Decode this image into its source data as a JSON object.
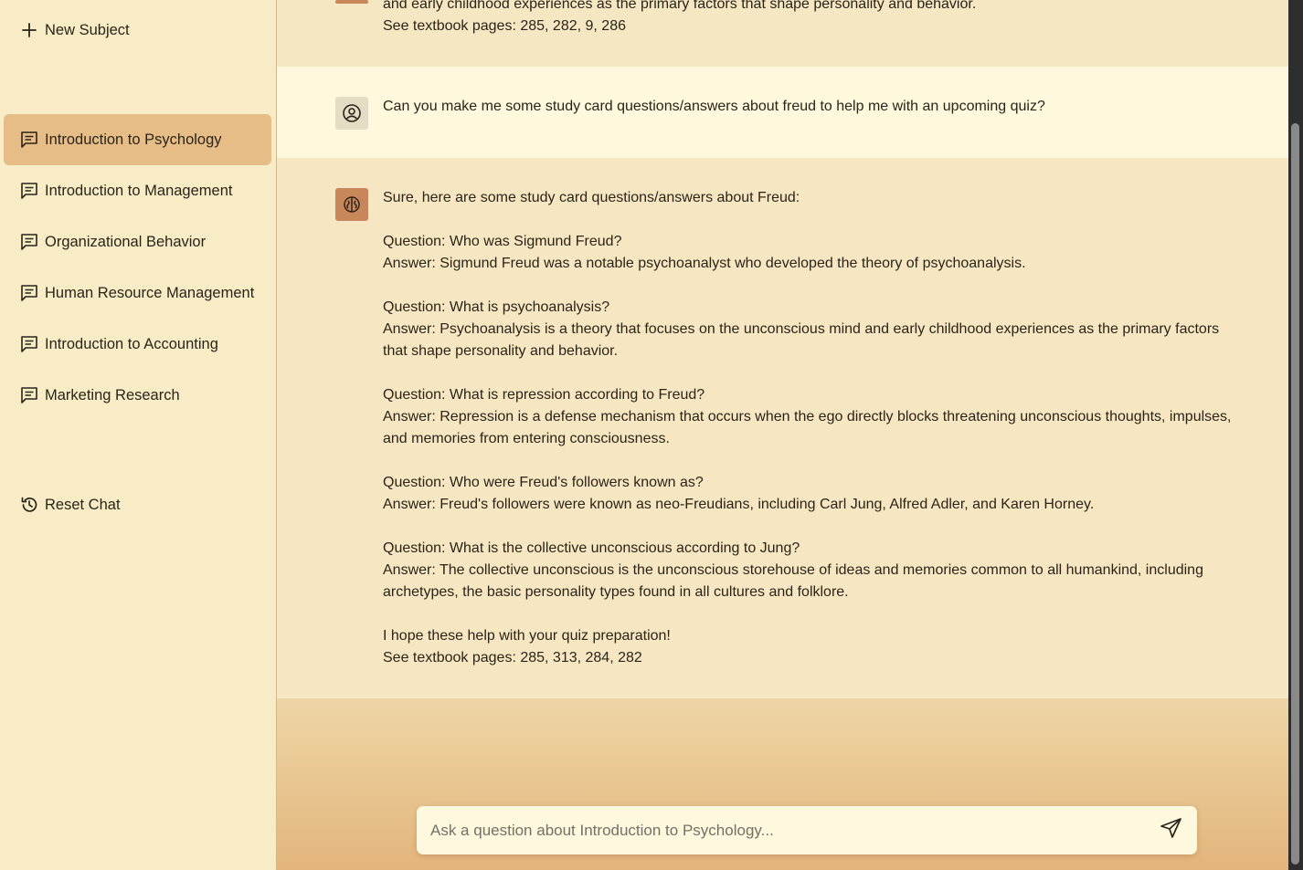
{
  "sidebar": {
    "new_subject_label": "New Subject",
    "subjects": [
      {
        "label": "Introduction to Psychology",
        "active": true
      },
      {
        "label": "Introduction to Management",
        "active": false
      },
      {
        "label": "Organizational Behavior",
        "active": false
      },
      {
        "label": "Human Resource Management",
        "active": false
      },
      {
        "label": "Introduction to Accounting",
        "active": false
      },
      {
        "label": "Marketing Research",
        "active": false
      }
    ],
    "reset_label": "Reset Chat"
  },
  "chat": {
    "previous_bot": {
      "line1": "and early childhood experiences as the primary factors that shape personality and behavior.",
      "line2": "See textbook pages: 285, 282, 9, 286"
    },
    "user_message": "Can you make me some study card questions/answers about freud to help me with an upcoming quiz?",
    "bot_message": {
      "intro": "Sure, here are some study card questions/answers about Freud:",
      "q1": "Question: Who was Sigmund Freud?",
      "a1": "Answer: Sigmund Freud was a notable psychoanalyst who developed the theory of psychoanalysis.",
      "q2": "Question: What is psychoanalysis?",
      "a2": "Answer: Psychoanalysis is a theory that focuses on the unconscious mind and early childhood experiences as the primary factors that shape personality and behavior.",
      "q3": "Question: What is repression according to Freud?",
      "a3": "Answer: Repression is a defense mechanism that occurs when the ego directly blocks threatening unconscious thoughts, impulses, and memories from entering consciousness.",
      "q4": "Question: Who were Freud's followers known as?",
      "a4": "Answer: Freud's followers were known as neo-Freudians, including Carl Jung, Alfred Adler, and Karen Horney.",
      "q5": "Question: What is the collective unconscious according to Jung?",
      "a5": "Answer: The collective unconscious is the unconscious storehouse of ideas and memories common to all humankind, including archetypes, the basic personality types found in all cultures and folklore.",
      "outro": "I hope these help with your quiz preparation!",
      "pages": "See textbook pages: 285, 313, 284, 282"
    }
  },
  "composer": {
    "placeholder": "Ask a question about Introduction to Psychology...",
    "value": ""
  },
  "colors": {
    "sidebar_bg": "#f7ecc6",
    "active_item": "#e6bd86",
    "bot_avatar": "#c8875a",
    "user_row_bg": "#fef8dc"
  }
}
